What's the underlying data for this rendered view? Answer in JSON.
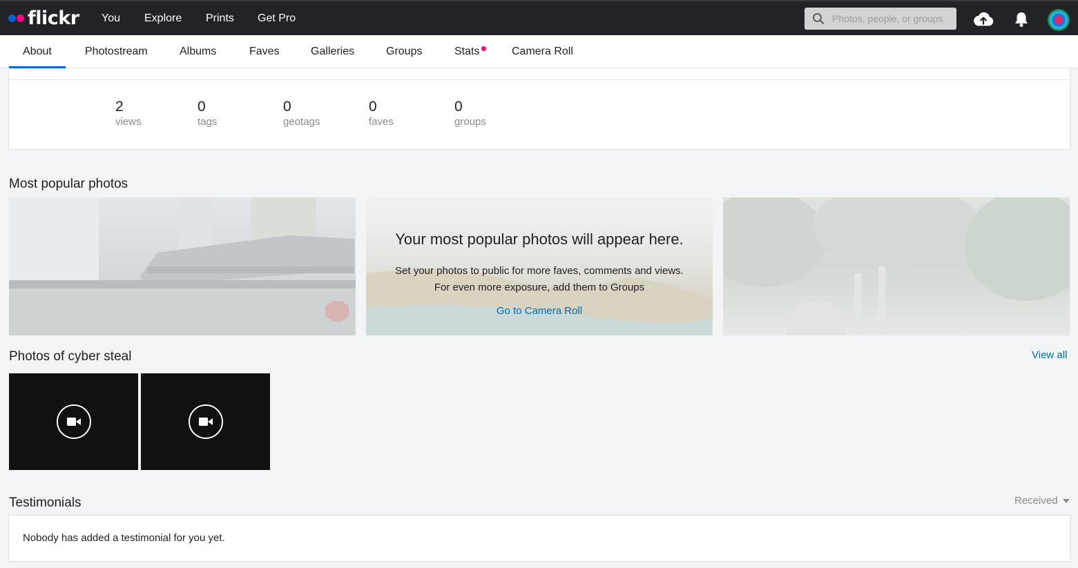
{
  "brand": {
    "name": "flickr",
    "colors": {
      "blue": "#0063dc",
      "pink": "#ff0084",
      "link": "#006dac"
    }
  },
  "topnav": {
    "items": [
      "You",
      "Explore",
      "Prints",
      "Get Pro"
    ],
    "search": {
      "placeholder": "Photos, people, or groups",
      "value": "",
      "icon": "search-icon"
    },
    "icons": [
      "upload-cloud-icon",
      "notifications-bell-icon",
      "user-avatar"
    ]
  },
  "subnav": {
    "tabs": [
      "About",
      "Photostream",
      "Albums",
      "Faves",
      "Galleries",
      "Groups",
      "Stats",
      "Camera Roll"
    ],
    "active": "About"
  },
  "stats": [
    {
      "value": "2",
      "label": "views"
    },
    {
      "value": "0",
      "label": "tags"
    },
    {
      "value": "0",
      "label": "geotags"
    },
    {
      "value": "0",
      "label": "faves"
    },
    {
      "value": "0",
      "label": "groups"
    }
  ],
  "popular": {
    "title": "Most popular photos",
    "headline": "Your most popular photos will appear here.",
    "line1": "Set your photos to public for more faves, comments and views.",
    "line2": "For even more exposure, add them to Groups",
    "link": "Go to Camera Roll"
  },
  "photos_of": {
    "title": "Photos of cyber steal",
    "view_all": "View all",
    "tiles": [
      {
        "icon": "video-camera-icon"
      },
      {
        "icon": "video-camera-icon"
      }
    ]
  },
  "testimonials": {
    "title": "Testimonials",
    "filter": "Received",
    "empty_text": "Nobody has added a testimonial for you yet."
  }
}
